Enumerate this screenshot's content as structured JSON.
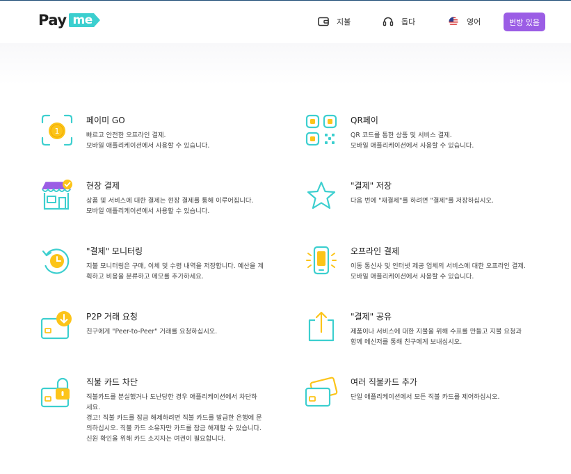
{
  "brand": {
    "logo_pay": "Pay",
    "logo_me": "me",
    "accent": "#3ccfcf",
    "purple": "#9b5de5",
    "yellow": "#fcc419"
  },
  "nav": {
    "payments_label": "지불",
    "help_label": "돕다",
    "language_label": "영어",
    "signup_label": "번방 있음"
  },
  "features": [
    {
      "title": "페이미 GO",
      "icon": "coin-scan-icon",
      "lines": [
        "빠르고 안전한 오프라인 결제.",
        "모바일 애플리케이션에서 사용할 수 있습니다."
      ]
    },
    {
      "title": "QR페이",
      "icon": "qr-code-icon",
      "lines": [
        "QR 코드를 통한 상품 및 서비스 결제.",
        "모바일 애플리케이션에서 사용할 수 있습니다."
      ]
    },
    {
      "title": "현장 결제",
      "icon": "store-icon",
      "lines": [
        "상품 및 서비스에 대한 결제는 현장 결제를 통해 이루어집니다.",
        "모바일 애플리케이션에서 사용할 수 있습니다."
      ]
    },
    {
      "title": "\"결제\" 저장",
      "icon": "star-icon",
      "lines": [
        "다음 번에 \"재결제\"를 하려면 \"결제\"를 저장하십시오."
      ]
    },
    {
      "title": "\"결제\" 모니터링",
      "icon": "history-clock-icon",
      "lines": [
        "지불 모니터링은 구매, 이체 및 수령 내역을 저장합니다. 예산을 계",
        "획하고 비용을 분류하고 메모를 추가하세요."
      ]
    },
    {
      "title": "오프라인 결제",
      "icon": "smartphone-icon",
      "lines": [
        "이동 통신사 및 인터넷 제공 업체의 서비스에 대한 오프라인 결제.",
        "모바일 애플리케이션에서 사용할 수 있습니다."
      ]
    },
    {
      "title": "P2P 거래 요청",
      "icon": "card-download-icon",
      "lines": [
        "친구에게 \"Peer-to-Peer\" 거래를 요청하십시오."
      ]
    },
    {
      "title": "\"결제\" 공유",
      "icon": "share-icon",
      "lines": [
        "제품이나 서비스에 대한 지불을 위해 수표를 만들고 지불 요청과",
        "함께 메신저를 통해 친구에게 보내십시오."
      ]
    },
    {
      "title": "직불 카드 차단",
      "icon": "card-lock-icon",
      "lines": [
        "직불카드를 분실했거나 도난당한 경우 애플리케이션에서 차단하",
        "세요.",
        "경고! 직불 카드를 잠금 해제하려면 직불 카드를 발급한 은행에 문",
        "의하십시오. 직불 카드 소유자만 카드를 잠금 해제할 수 있습니다.",
        "신원 확인을 위해 카드 소지자는 여권이 필요합니다."
      ]
    },
    {
      "title": "여러 직불카드 추가",
      "icon": "multiple-cards-icon",
      "lines": [
        "단일 애플리케이션에서 모든 직불 카드를 제어하십시오."
      ]
    }
  ]
}
